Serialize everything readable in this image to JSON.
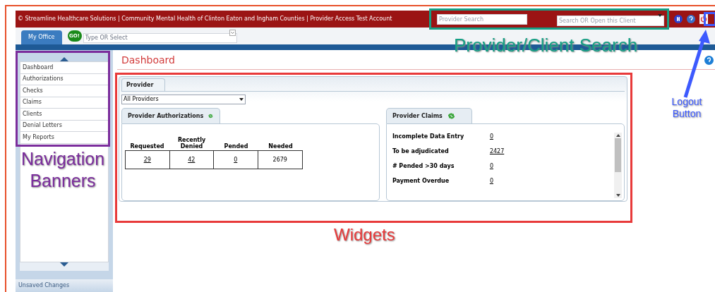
{
  "header": {
    "text": "© Streamline Healthcare Solutions | Community Mental Health of Clinton Eaton and Ingham Counties | Provider Access Test Account",
    "provider_search": {
      "placeholder": "Provider Search"
    },
    "client_search": {
      "placeholder": "Search OR Open this Client"
    }
  },
  "toolbar": {
    "tab": {
      "label": "My Office",
      "selected": true
    },
    "go_button": "GO!",
    "quick_select": {
      "placeholder": "Type OR Select"
    }
  },
  "sidebar": {
    "items": [
      "Dashboard",
      "Authorizations",
      "Checks",
      "Claims",
      "Clients",
      "Denial Letters",
      "My Reports"
    ],
    "footer": "Unsaved Changes"
  },
  "page_title": "Dashboard",
  "provider_tab": {
    "label": "Provider",
    "selected": true
  },
  "provider_select": "All Providers",
  "authorizations": {
    "title": "Provider Authorizations",
    "columns": [
      "Requested",
      "Recently Denied",
      "Pended",
      "Needed"
    ],
    "values": [
      {
        "text": "29",
        "link": true
      },
      {
        "text": "42",
        "link": true
      },
      {
        "text": "0",
        "link": true
      },
      {
        "text": "2679",
        "link": false
      }
    ]
  },
  "claims": {
    "title": "Provider Claims",
    "rows": [
      {
        "label": "Incomplete Data Entry",
        "value": "0"
      },
      {
        "label": "To be adjudicated",
        "value": "2427"
      },
      {
        "label": "# Pended >30 days",
        "value": "0"
      },
      {
        "label": "Payment Overdue",
        "value": "0"
      }
    ]
  },
  "annotations": [
    {
      "text": "Provider/Client Search",
      "color": "#16a085"
    },
    {
      "text": "Navigation Banners",
      "color": "#7b2d9c"
    },
    {
      "text": "Widgets",
      "color": "#e83a3a"
    },
    {
      "text": "Logout Button",
      "color": "#3d5afe"
    }
  ]
}
